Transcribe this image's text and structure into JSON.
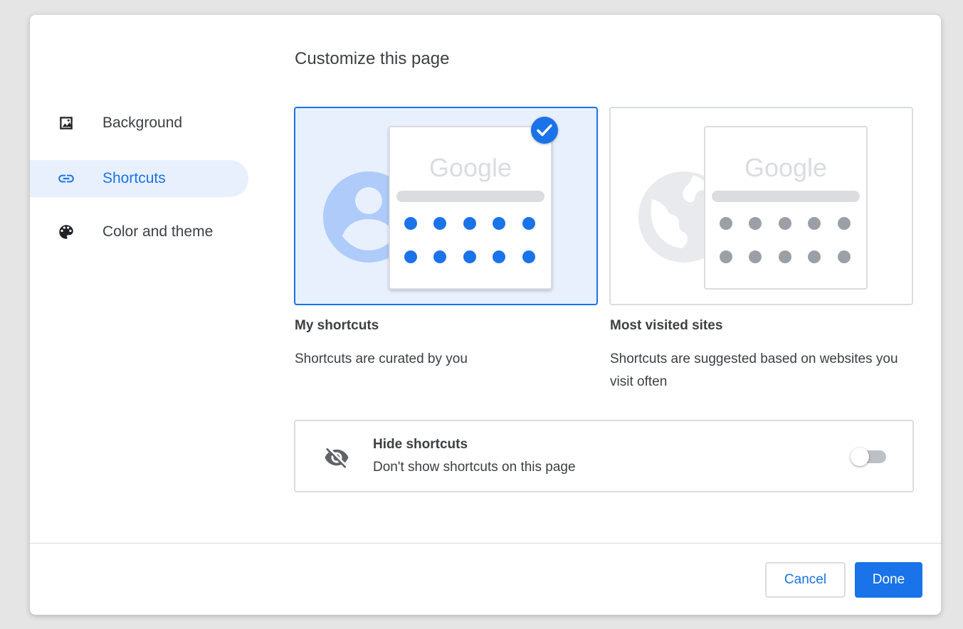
{
  "dialog": {
    "title": "Customize this page"
  },
  "sidebar": {
    "items": [
      {
        "label": "Background",
        "icon": "image-icon",
        "active": false
      },
      {
        "label": "Shortcuts",
        "icon": "link-icon",
        "active": true
      },
      {
        "label": "Color and theme",
        "icon": "palette-icon",
        "active": false
      }
    ]
  },
  "options": [
    {
      "title": "My shortcuts",
      "description": "Shortcuts are curated by you",
      "selected": true,
      "logo_text": "Google",
      "icon": "person-icon"
    },
    {
      "title": "Most visited sites",
      "description": "Shortcuts are suggested based on websites you visit often",
      "selected": false,
      "logo_text": "Google",
      "icon": "globe-icon"
    }
  ],
  "hide_shortcuts": {
    "title": "Hide shortcuts",
    "subtitle": "Don't show shortcuts on this page",
    "icon": "eye-off-icon",
    "enabled": false
  },
  "footer": {
    "cancel_label": "Cancel",
    "done_label": "Done"
  },
  "colors": {
    "accent": "#1a73e8",
    "selected_bg": "#e8f0fe",
    "text": "#3c4043",
    "border": "#dadce0",
    "muted_dot": "#9aa0a6"
  }
}
